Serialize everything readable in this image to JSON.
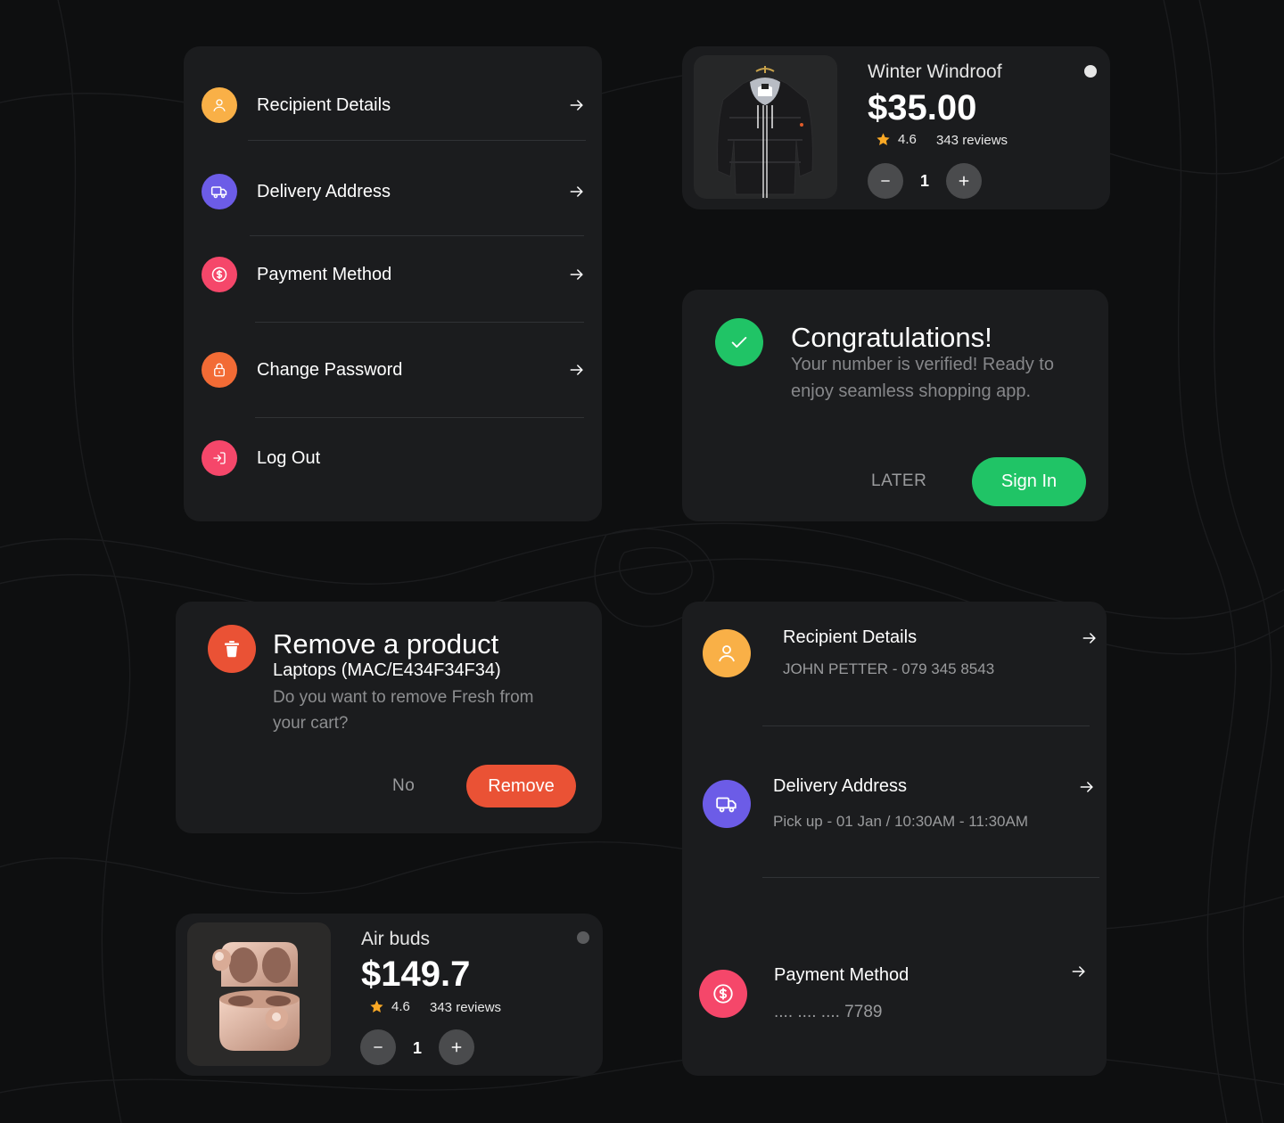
{
  "colors": {
    "background": "#0e0f10",
    "card": "#1b1c1e",
    "orange_icon": "#f9b047",
    "purple_icon": "#6c5ce7",
    "pink_icon": "#f5476a",
    "deep_orange_icon": "#f26b35",
    "green": "#20c466",
    "red": "#ea5235"
  },
  "menu": {
    "items": [
      {
        "label": "Recipient Details",
        "icon": "user-icon"
      },
      {
        "label": "Delivery Address",
        "icon": "truck-icon"
      },
      {
        "label": "Payment Method",
        "icon": "dollar-icon"
      },
      {
        "label": "Change Password",
        "icon": "lock-icon"
      },
      {
        "label": "Log Out",
        "icon": "logout-icon"
      }
    ]
  },
  "product_jacket": {
    "name": "Winter Windroof",
    "price": "$35.00",
    "rating": "4.6",
    "reviews": "343 reviews",
    "quantity": "1",
    "image": "jacket-image"
  },
  "congrats": {
    "title": "Congratulations!",
    "message": "Your number is verified! Ready to enjoy seamless shopping app.",
    "later_label": "LATER",
    "signin_label": "Sign In"
  },
  "remove": {
    "title": "Remove a product",
    "subtitle": "Laptops (MAC/E434F34F34)",
    "message": "Do you want to remove Fresh from your cart?",
    "no_label": "No",
    "remove_label": "Remove"
  },
  "product_buds": {
    "name": "Air buds",
    "price": "$149.7",
    "rating": "4.6",
    "reviews": "343 reviews",
    "quantity": "1",
    "image": "earbuds-image"
  },
  "details": {
    "recipient": {
      "title": "Recipient Details",
      "value": "JOHN PETTER - 079 345 8543"
    },
    "delivery": {
      "title": "Delivery Address",
      "value": "Pick up - 01 Jan / 10:30AM - 11:30AM"
    },
    "payment": {
      "title": "Payment Method",
      "value": ".... .... .... 7789"
    }
  }
}
